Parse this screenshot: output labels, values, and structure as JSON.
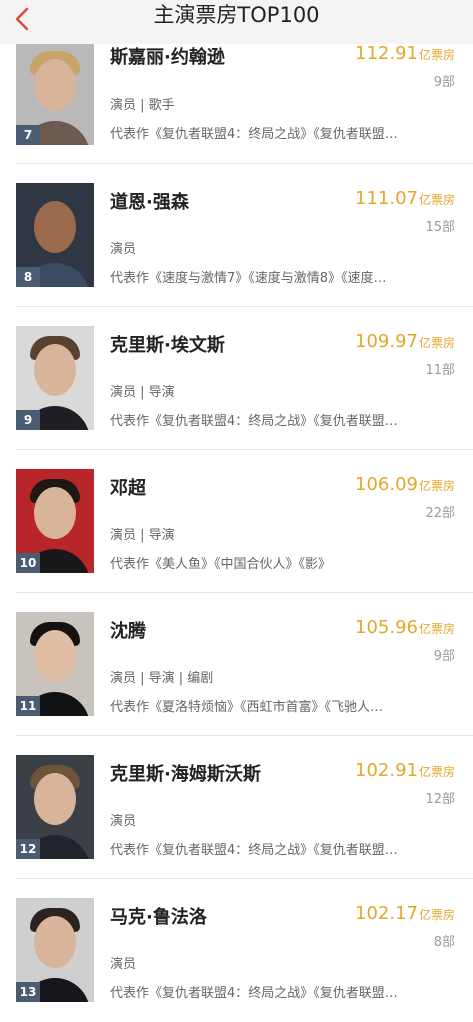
{
  "header": {
    "title": "主演票房TOP100"
  },
  "unit_label": "亿票房",
  "rows": [
    {
      "rank": "7",
      "name": "斯嘉丽·约翰逊",
      "box": "112.91",
      "works_count": "9部",
      "roles": "演员 | 歌手",
      "works": "代表作《复仇者联盟4：终局之战》《复仇者联盟…"
    },
    {
      "rank": "8",
      "name": "道恩·强森",
      "box": "111.07",
      "works_count": "15部",
      "roles": "演员",
      "works": "代表作《速度与激情7》《速度与激情8》《速度…"
    },
    {
      "rank": "9",
      "name": "克里斯·埃文斯",
      "box": "109.97",
      "works_count": "11部",
      "roles": "演员 | 导演",
      "works": "代表作《复仇者联盟4：终局之战》《复仇者联盟…"
    },
    {
      "rank": "10",
      "name": "邓超",
      "box": "106.09",
      "works_count": "22部",
      "roles": "演员 | 导演",
      "works": "代表作《美人鱼》《中国合伙人》《影》"
    },
    {
      "rank": "11",
      "name": "沈腾",
      "box": "105.96",
      "works_count": "9部",
      "roles": "演员 | 导演 | 编剧",
      "works": "代表作《夏洛特烦恼》《西虹市首富》《飞驰人…"
    },
    {
      "rank": "12",
      "name": "克里斯·海姆斯沃斯",
      "box": "102.91",
      "works_count": "12部",
      "roles": "演员",
      "works": "代表作《复仇者联盟4：终局之战》《复仇者联盟…"
    },
    {
      "rank": "13",
      "name": "马克·鲁法洛",
      "box": "102.17",
      "works_count": "8部",
      "roles": "演员",
      "works": "代表作《复仇者联盟4：终局之战》《复仇者联盟…"
    }
  ]
}
